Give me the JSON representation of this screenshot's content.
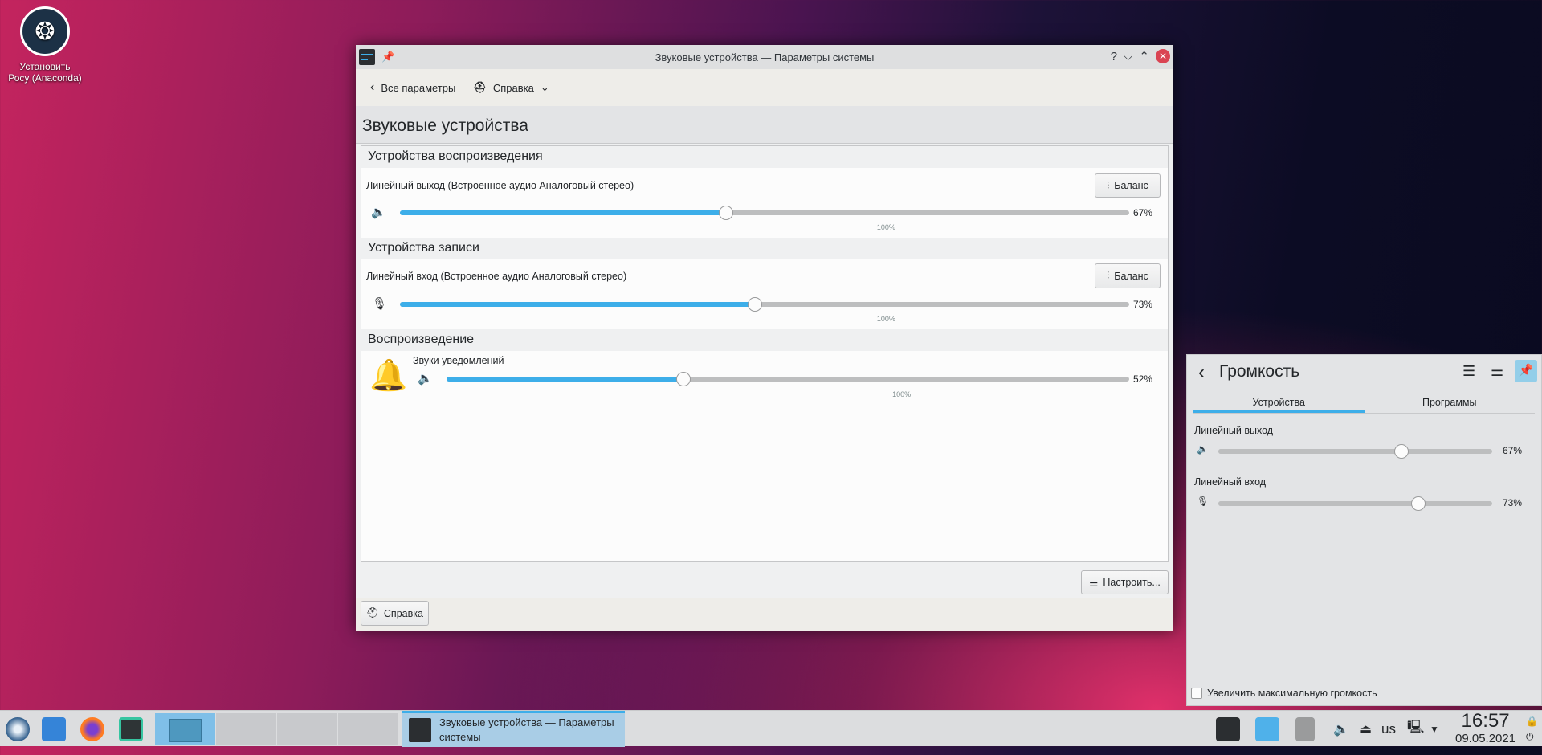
{
  "desktop": {
    "icon_label": "Установить Росу (Anaconda)"
  },
  "window": {
    "title": "Звуковые устройства — Параметры системы",
    "toolbar": {
      "back": "Все параметры",
      "help": "Справка"
    },
    "page_title": "Звуковые устройства",
    "sections": {
      "playback": "Устройства воспроизведения",
      "capture": "Устройства записи",
      "streams": "Воспроизведение"
    },
    "devices": [
      {
        "name": "Линейный выход (Встроенное аудио Аналоговый стерео)",
        "volume": 67,
        "volume_label": "67%",
        "max": 150,
        "mark_label": "100%",
        "button": "Баланс"
      },
      {
        "name": "Линейный вход (Встроенное аудио Аналоговый стерео)",
        "volume": 73,
        "volume_label": "73%",
        "max": 150,
        "mark_label": "100%",
        "button": "Баланс"
      }
    ],
    "stream": {
      "name": "Звуки уведомлений",
      "volume": 52,
      "volume_label": "52%",
      "max": 150,
      "mark_label": "100%"
    },
    "configure_button": "Настроить...",
    "help_button": "Справка"
  },
  "plasmoid": {
    "title": "Громкость",
    "tabs": [
      "Устройства",
      "Программы"
    ],
    "devices": [
      {
        "name": "Линейный выход",
        "volume": 67,
        "volume_label": "67%"
      },
      {
        "name": "Линейный вход",
        "volume": 73,
        "volume_label": "73%"
      }
    ],
    "raise_max_label": "Увеличить максимальную громкость",
    "raise_max_checked": false
  },
  "taskbar": {
    "task_title": "Звуковые устройства  — Параметры системы",
    "keyboard_layout": "us",
    "time": "16:57",
    "date": "09.05.2021"
  },
  "colors": {
    "accent": "#3daee9",
    "close": "#da4453"
  }
}
